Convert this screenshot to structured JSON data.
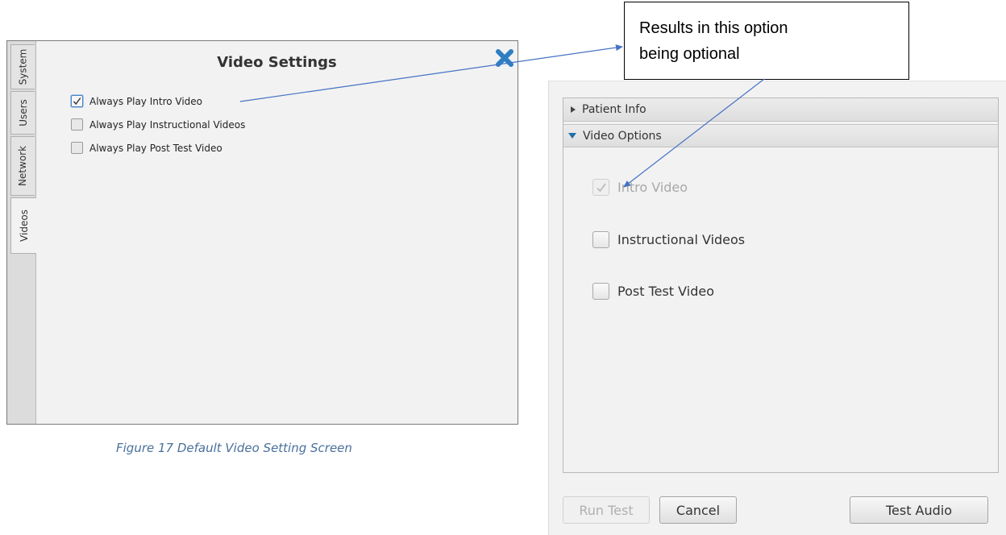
{
  "settings_window": {
    "tabs": [
      "System",
      "Users",
      "Network",
      "Videos"
    ],
    "active_tab": "Videos",
    "title": "Video Settings",
    "options": [
      {
        "label": "Always Play Intro Video",
        "checked": true
      },
      {
        "label": "Always Play Instructional Videos",
        "checked": false
      },
      {
        "label": "Always Play Post Test Video",
        "checked": false
      }
    ]
  },
  "caption": "Figure 17 Default Video Setting Screen",
  "options_panel": {
    "sections": [
      {
        "label": "Patient Info",
        "expanded": false
      },
      {
        "label": "Video Options",
        "expanded": true
      }
    ],
    "video_options": [
      {
        "label": "Intro Video",
        "checked": true,
        "disabled": true
      },
      {
        "label": "Instructional Videos",
        "checked": false,
        "disabled": false
      },
      {
        "label": "Post Test Video",
        "checked": false,
        "disabled": false
      }
    ],
    "buttons": {
      "run_test": "Run Test",
      "cancel": "Cancel",
      "test_audio": "Test Audio"
    }
  },
  "callout": {
    "line1": "Results in this option",
    "line2": "being optional"
  },
  "colors": {
    "accent_blue": "#4472c4",
    "close_icon": "#2e7fc2",
    "caption": "#4a6f9c"
  }
}
